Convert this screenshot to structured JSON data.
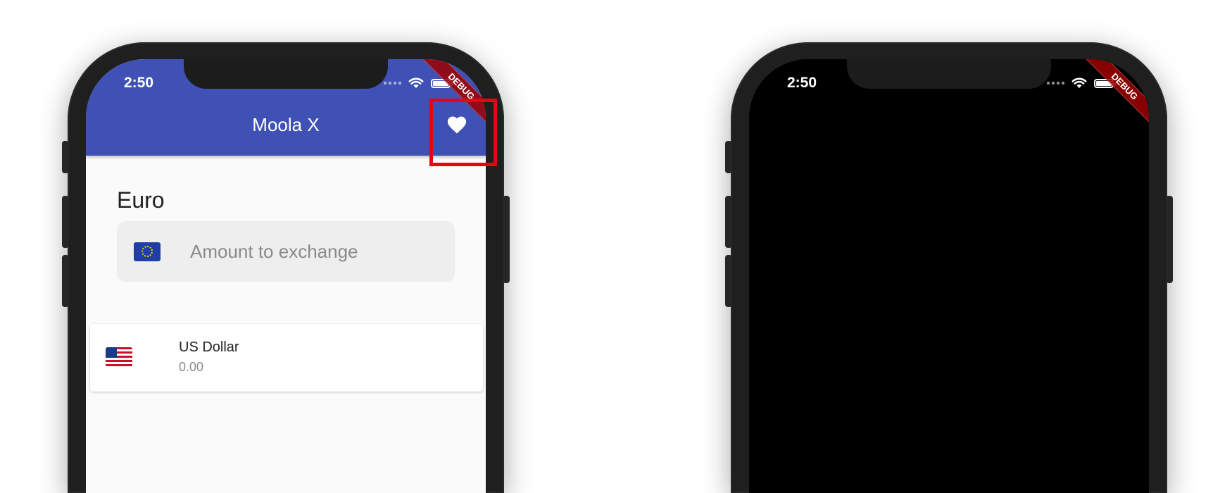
{
  "left_phone": {
    "status_time": "2:50",
    "app_title": "Moola X",
    "debug_label": "DEBUG",
    "base_currency": {
      "label": "Euro",
      "placeholder": "Amount to exchange"
    },
    "results": [
      {
        "currency": "US Dollar",
        "value": "0.00",
        "flag": "us-flag-icon"
      }
    ],
    "icons": {
      "favorite": "heart-icon"
    },
    "colors": {
      "app_bar": "#3f51b5",
      "highlight": "#e30613"
    }
  },
  "right_phone": {
    "status_time": "2:50",
    "debug_label": "DEBUG"
  }
}
